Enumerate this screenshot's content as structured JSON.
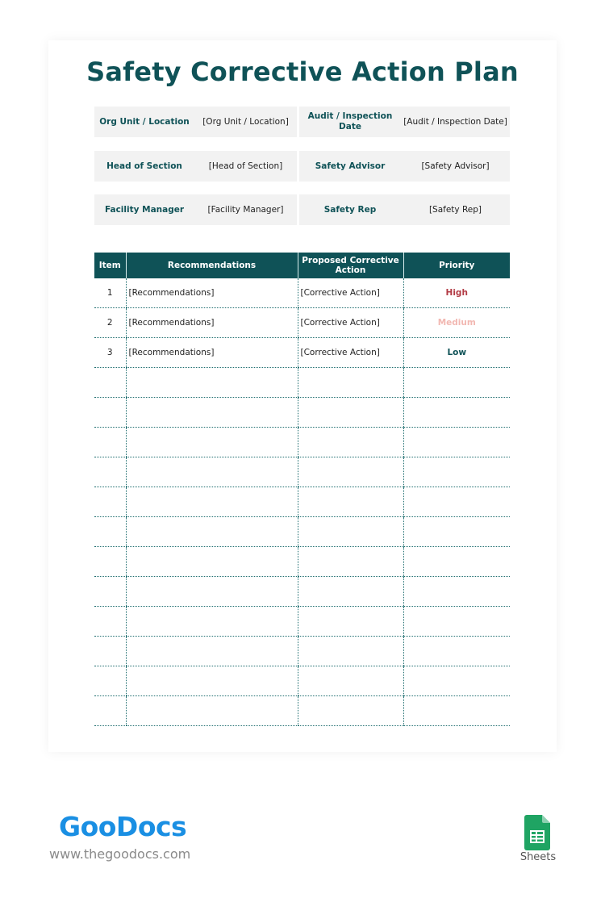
{
  "document": {
    "title": "Safety Corrective Action Plan"
  },
  "info_rows": [
    [
      {
        "label": "Org Unit / Location",
        "value": "[Org Unit / Location]"
      },
      {
        "label": "Audit / Inspection Date",
        "value": "[Audit / Inspection Date]"
      }
    ],
    [
      {
        "label": "Head of Section",
        "value": "[Head of Section]"
      },
      {
        "label": "Safety Advisor",
        "value": "[Safety Advisor]"
      }
    ],
    [
      {
        "label": "Facility Manager",
        "value": "[Facility Manager]"
      },
      {
        "label": "Safety Rep",
        "value": "[Safety Rep]"
      }
    ]
  ],
  "table": {
    "headers": [
      "Item",
      "Recommendations",
      "Proposed Corrective Action",
      "Priority"
    ],
    "rows": [
      {
        "item": "1",
        "recommendation": "[Recommendations]",
        "action": "[Corrective Action]",
        "priority": "High",
        "priority_color": "#b23b45"
      },
      {
        "item": "2",
        "recommendation": "[Recommendations]",
        "action": "[Corrective Action]",
        "priority": "Medium",
        "priority_color": "#f2b8b2"
      },
      {
        "item": "3",
        "recommendation": "[Recommendations]",
        "action": "[Corrective Action]",
        "priority": "Low",
        "priority_color": "#0f5257"
      }
    ],
    "empty_rows": 12
  },
  "branding": {
    "logo": "GooDocs",
    "url": "www.thegoodocs.com",
    "app_label": "Sheets",
    "app_icon": "google-sheets-icon"
  },
  "colors": {
    "primary": "#0f5257",
    "logo_blue": "#1a8fe3",
    "sheets_green": "#1fa463"
  }
}
